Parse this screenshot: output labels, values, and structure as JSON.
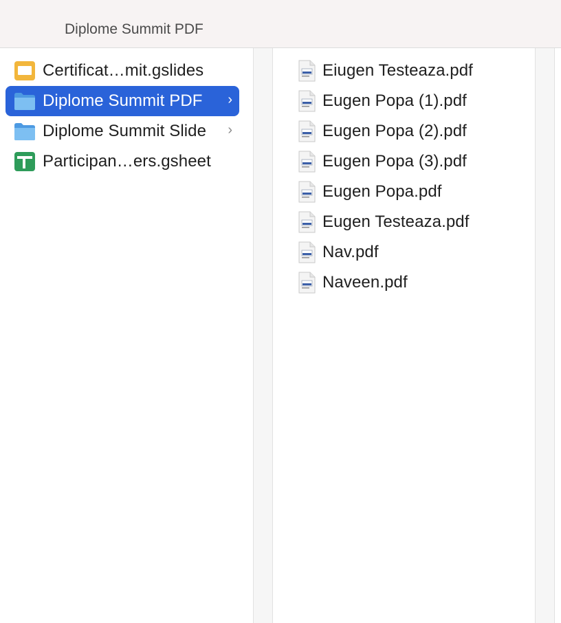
{
  "window": {
    "title": "Diplome Summit PDF"
  },
  "sidebar": {
    "items": [
      {
        "label": "Certificat…mit.gslides",
        "icon": "gslides-icon",
        "selected": false,
        "has_children": false
      },
      {
        "label": "Diplome Summit PDF",
        "icon": "folder-icon",
        "selected": true,
        "has_children": true,
        "chevron": "›"
      },
      {
        "label": "Diplome Summit Slide",
        "icon": "folder-icon",
        "selected": false,
        "has_children": true,
        "chevron": "›"
      },
      {
        "label": "Participan…ers.gsheet",
        "icon": "gsheet-icon",
        "selected": false,
        "has_children": false
      }
    ]
  },
  "files": {
    "items": [
      {
        "label": "Eiugen Testeaza.pdf",
        "icon": "pdf-file-icon"
      },
      {
        "label": "Eugen Popa (1).pdf",
        "icon": "pdf-file-icon"
      },
      {
        "label": "Eugen Popa (2).pdf",
        "icon": "pdf-file-icon"
      },
      {
        "label": "Eugen Popa (3).pdf",
        "icon": "pdf-file-icon"
      },
      {
        "label": "Eugen Popa.pdf",
        "icon": "pdf-file-icon"
      },
      {
        "label": "Eugen Testeaza.pdf",
        "icon": "pdf-file-icon"
      },
      {
        "label": "Nav.pdf",
        "icon": "pdf-file-icon"
      },
      {
        "label": "Naveen.pdf",
        "icon": "pdf-file-icon"
      }
    ]
  },
  "colors": {
    "selection": "#2a63d9",
    "folder": "#5aa8e8",
    "gslides": "#f2b63c",
    "gsheet": "#2e9c5a"
  }
}
